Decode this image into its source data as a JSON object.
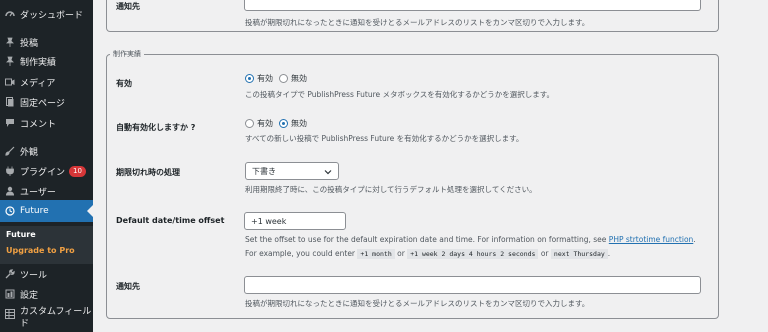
{
  "sidebar": {
    "items": [
      {
        "name": "dashboard",
        "label": "ダッシュボード",
        "icon": "dashboard-icon"
      },
      {
        "name": "posts",
        "label": "投稿",
        "icon": "pin-icon"
      },
      {
        "name": "works",
        "label": "制作実績",
        "icon": "pin-icon"
      },
      {
        "name": "media",
        "label": "メディア",
        "icon": "media-icon"
      },
      {
        "name": "pages",
        "label": "固定ページ",
        "icon": "page-icon"
      },
      {
        "name": "comments",
        "label": "コメント",
        "icon": "comment-icon"
      },
      {
        "name": "appearance",
        "label": "外観",
        "icon": "brush-icon"
      },
      {
        "name": "plugins",
        "label": "プラグイン",
        "icon": "plugin-icon",
        "badge": "10"
      },
      {
        "name": "users",
        "label": "ユーザー",
        "icon": "user-icon"
      },
      {
        "name": "future",
        "label": "Future",
        "icon": "clock-icon",
        "active": true
      },
      {
        "name": "tools",
        "label": "ツール",
        "icon": "wrench-icon"
      },
      {
        "name": "settings",
        "label": "設定",
        "icon": "settings-icon"
      },
      {
        "name": "custom-fields",
        "label": "カスタムフィールド",
        "icon": "table-icon"
      }
    ],
    "submenu": {
      "future_label": "Future",
      "upgrade_label": "Upgrade to Pro"
    },
    "colors": {
      "background": "#1d2327",
      "active": "#2271b1",
      "upgrade": "#f0a043",
      "badge": "#d63638"
    }
  },
  "top_section": {
    "notify_label": "通知先",
    "notify_value": "",
    "notify_desc": "投稿が期限切れになったときに通知を受けとるメールアドレスのリストをカンマ区切りで入力します。"
  },
  "section": {
    "legend": "制作実績",
    "active": {
      "label": "有効",
      "options": [
        {
          "label": "有効",
          "checked": true
        },
        {
          "label": "無効",
          "checked": false
        }
      ],
      "desc": "この投稿タイプで PublishPress Future メタボックスを有効化するかどうかを選択します。"
    },
    "auto_enable": {
      "label": "自動有効化しますか ?",
      "options": [
        {
          "label": "有効",
          "checked": false
        },
        {
          "label": "無効",
          "checked": true
        }
      ],
      "desc": "すべての新しい投稿で PublishPress Future を有効化するかどうかを選択します。"
    },
    "expiration_action": {
      "label": "期限切れ時の処理",
      "selected": "下書き",
      "desc": "利用期限終了時に、この投稿タイプに対して行うデフォルト処理を選択してください。"
    },
    "date_offset": {
      "label": "Default date/time offset",
      "value": "+1 week",
      "desc_line1_prefix": "Set the offset to use for the default expiration date and time. For information on formatting, see",
      "desc_link": "PHP strtotime function",
      "desc_line1_suffix": ".",
      "desc_line2_prefix": "For example, you could enter",
      "example1": "+1 month",
      "or1": "or",
      "example2": "+1 week 2 days 4 hours 2 seconds",
      "or2": "or",
      "example3": "next Thursday",
      "desc_line2_suffix": "."
    },
    "notify": {
      "label": "通知先",
      "value": "",
      "desc": "投稿が期限切れになったときに通知を受けとるメールアドレスのリストをカンマ区切りで入力します。"
    }
  }
}
